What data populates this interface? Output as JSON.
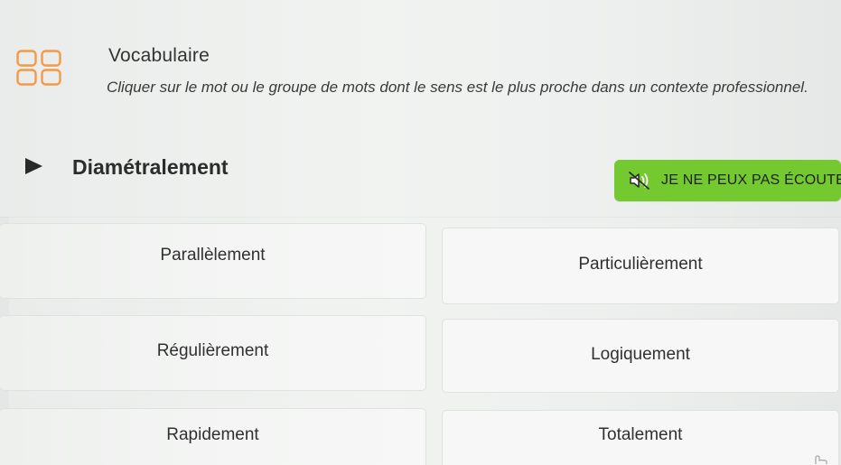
{
  "activity": {
    "icon": "grid-squares-icon",
    "title": "Vocabulaire",
    "instruction": "Cliquer sur le mot ou le groupe de mots dont le sens est le plus proche dans un contexte professionnel."
  },
  "prompt": {
    "play_icon": "play-icon",
    "word": "Diamétralement"
  },
  "cant_listen_button": {
    "icon": "sound-off-icon",
    "label": "JE NE PEUX PAS ÉCOUTER",
    "color": "#73c92f"
  },
  "choices": [
    {
      "label": "Parallèlement"
    },
    {
      "label": "Particulièrement"
    },
    {
      "label": "Régulièrement"
    },
    {
      "label": "Logiquement"
    },
    {
      "label": "Rapidement"
    },
    {
      "label": "Totalement"
    }
  ],
  "colors": {
    "background": "#eef0ef",
    "choice_border": "#dfe2df",
    "choice_background": "#f6f7f6",
    "accent": "#73c92f"
  }
}
